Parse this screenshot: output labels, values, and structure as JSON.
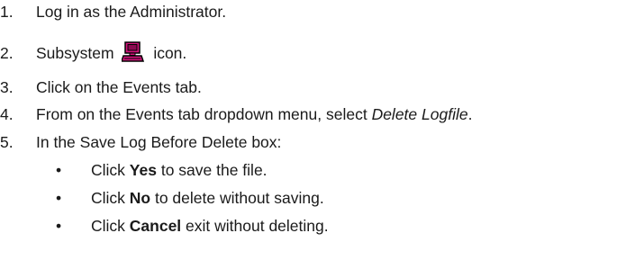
{
  "steps": [
    {
      "num": "1.",
      "text": "Log in as the Administrator."
    },
    {
      "num": "2.",
      "before": "Subsystem",
      "icon": "subsystem-computer-icon",
      "after": "icon."
    },
    {
      "num": "3.",
      "text": "Click on the Events tab."
    },
    {
      "num": "4.",
      "before": "From on the Events tab dropdown menu, select ",
      "italic": "Delete Logfile",
      "after": "."
    },
    {
      "num": "5.",
      "text": "In the Save Log Before Delete box:"
    }
  ],
  "bullets": [
    {
      "symbol": "•",
      "before": "Click ",
      "bold": "Yes",
      "after": " to save the file."
    },
    {
      "symbol": "•",
      "before": "Click ",
      "bold": "No",
      "after": " to delete without saving."
    },
    {
      "symbol": "•",
      "before": "Click ",
      "bold": "Cancel",
      "after": " exit without deleting."
    }
  ],
  "colors": {
    "text": "#1a1a1a",
    "icon_body": "#d4147c",
    "icon_outline": "#000000"
  }
}
